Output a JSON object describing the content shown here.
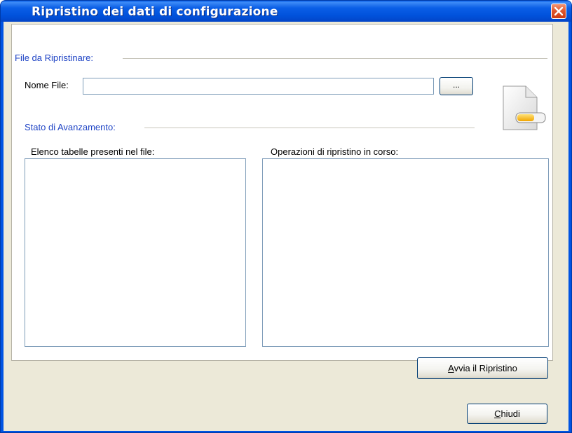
{
  "window": {
    "title": "Ripristino dei dati di configurazione"
  },
  "file_section": {
    "label": "File da Ripristinare:",
    "filename_label": "Nome File:",
    "filename_value": "",
    "browse_label": "..."
  },
  "progress_section": {
    "label": "Stato di Avanzamento:",
    "tables_list_label": "Elenco tabelle presenti nel file:",
    "operations_list_label": "Operazioni di ripristino in corso:",
    "tables_items": [],
    "operations_items": []
  },
  "buttons": {
    "start_restore_mnemonic": "A",
    "start_restore_rest": "vvia il Ripristino",
    "close_mnemonic": "C",
    "close_rest": "hiudi"
  },
  "icons": {
    "close": "close-icon",
    "file": "file-restore-icon"
  },
  "colors": {
    "titlebar": "#0054e3",
    "section_label": "#1f44c5",
    "window_background": "#ece9d8",
    "close_button": "#e0582f"
  }
}
